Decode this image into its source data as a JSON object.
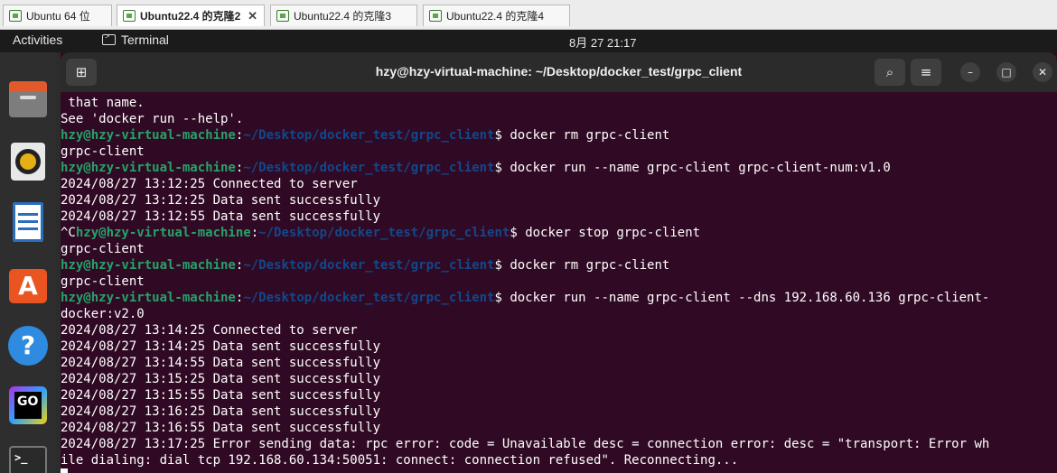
{
  "vm_tabs": [
    {
      "label": "Ubuntu 64 位"
    },
    {
      "label": "Ubuntu22.4 的克隆2"
    },
    {
      "label": "Ubuntu22.4 的克隆3"
    },
    {
      "label": "Ubuntu22.4 的克隆4"
    }
  ],
  "topbar": {
    "activities": "Activities",
    "app_name": "Terminal",
    "clock": "8月 27  21:17"
  },
  "dock": {
    "items": [
      "Files",
      "Rhythmbox",
      "LibreOffice Writer",
      "Ubuntu Software",
      "Help",
      "GoLand",
      "Terminal"
    ]
  },
  "window": {
    "title": "hzy@hzy-virtual-machine: ~/Desktop/docker_test/grpc_client"
  },
  "terminal": {
    "prompt_user": "hzy@hzy-virtual-machine",
    "prompt_path": "~/Desktop/docker_test/grpc_client",
    "lines": [
      {
        "text": " that name."
      },
      {
        "text": "See 'docker run --help'."
      },
      {
        "prompt": true,
        "cmd": "docker rm grpc-client"
      },
      {
        "text": "grpc-client"
      },
      {
        "prompt": true,
        "cmd": "docker run --name grpc-client grpc-client-num:v1.0"
      },
      {
        "text": "2024/08/27 13:12:25 Connected to server"
      },
      {
        "text": "2024/08/27 13:12:25 Data sent successfully"
      },
      {
        "text": "2024/08/27 13:12:55 Data sent successfully"
      },
      {
        "prompt": true,
        "pre": "^C",
        "cmd": "docker stop grpc-client"
      },
      {
        "text": "grpc-client"
      },
      {
        "prompt": true,
        "cmd": "docker rm grpc-client"
      },
      {
        "text": "grpc-client"
      },
      {
        "prompt": true,
        "cmd": "docker run --name grpc-client --dns 192.168.60.136 grpc-client-"
      },
      {
        "text": "docker:v2.0"
      },
      {
        "text": "2024/08/27 13:14:25 Connected to server"
      },
      {
        "text": "2024/08/27 13:14:25 Data sent successfully"
      },
      {
        "text": "2024/08/27 13:14:55 Data sent successfully"
      },
      {
        "text": "2024/08/27 13:15:25 Data sent successfully"
      },
      {
        "text": "2024/08/27 13:15:55 Data sent successfully"
      },
      {
        "text": "2024/08/27 13:16:25 Data sent successfully"
      },
      {
        "text": "2024/08/27 13:16:55 Data sent successfully"
      },
      {
        "text": "2024/08/27 13:17:25 Error sending data: rpc error: code = Unavailable desc = connection error: desc = \"transport: Error wh"
      },
      {
        "text": "ile dialing: dial tcp 192.168.60.134:50051: connect: connection refused\". Reconnecting..."
      },
      {
        "text": "",
        "cursor": true
      }
    ]
  },
  "colors": {
    "terminal_bg": "#300a24",
    "prompt_user": "#26a269",
    "prompt_path": "#12488b"
  }
}
